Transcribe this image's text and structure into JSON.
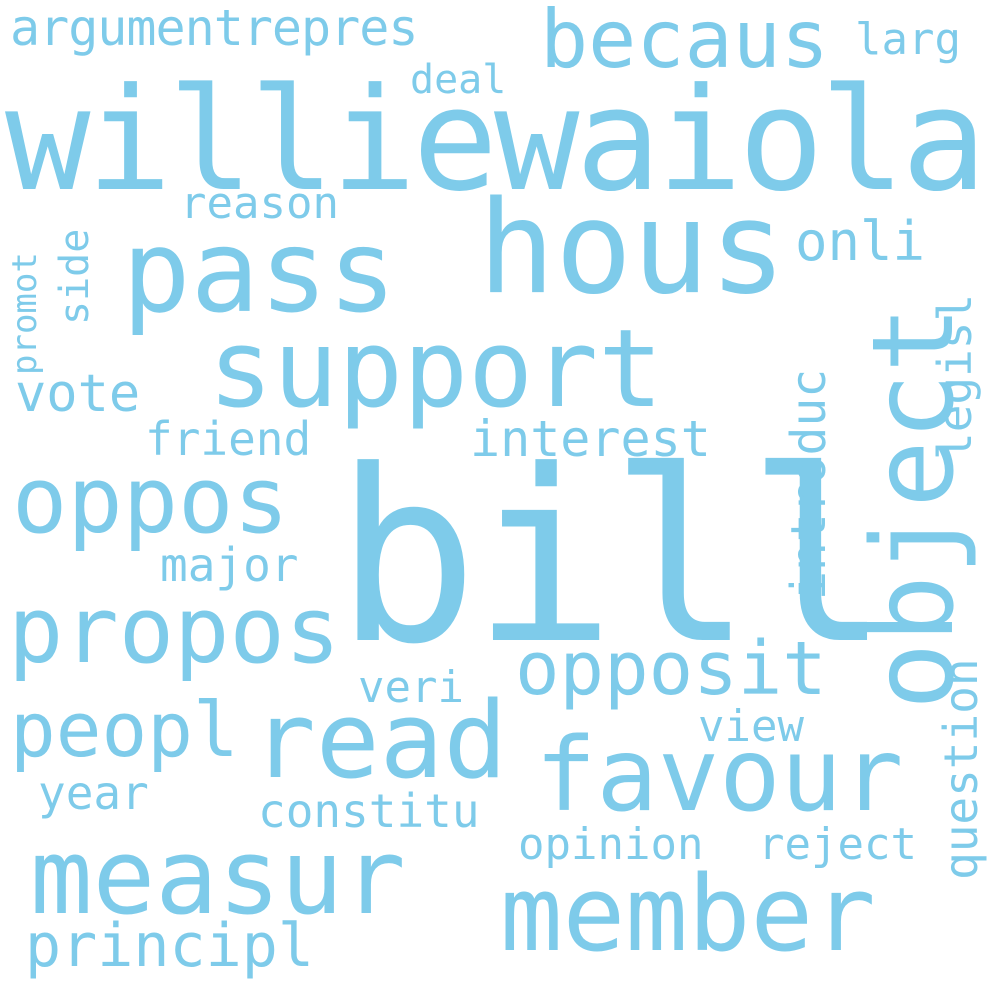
{
  "word_color": "#7ecbea",
  "background_color": "#ffffff",
  "words": {
    "bill": "bill",
    "williewaiola": "williewaiola",
    "hous": "hous",
    "pass": "pass",
    "support": "support",
    "object": "object",
    "oppos": "oppos",
    "propos": "propos",
    "opposit": "opposit",
    "read": "read",
    "favour": "favour",
    "measur": "measur",
    "member": "member",
    "peopl": "peopl",
    "becaus": "becaus",
    "argumentrepres": "argumentrepres",
    "larg": "larg",
    "deal": "deal",
    "reason": "reason",
    "onli": "onli",
    "introduc": "introduc",
    "legisl": "legisl",
    "promot": "promot",
    "side": "side",
    "vote": "vote",
    "friend": "friend",
    "interest": "interest",
    "major": "major",
    "veri": "veri",
    "view": "view",
    "question": "question",
    "year": "year",
    "constitu": "constitu",
    "opinion": "opinion",
    "reject": "reject",
    "principl": "principl"
  }
}
